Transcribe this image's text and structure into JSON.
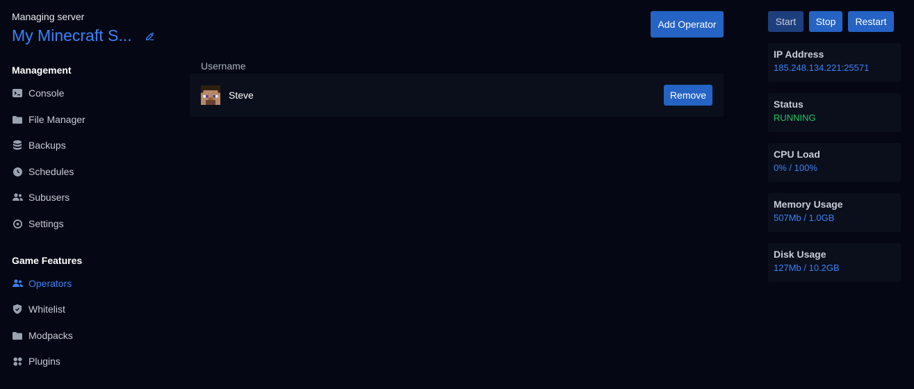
{
  "sidebar": {
    "managing_label": "Managing server",
    "server_name": "My Minecraft S...",
    "management_title": "Management",
    "management_items": [
      {
        "label": "Console",
        "icon": "terminal-icon"
      },
      {
        "label": "File Manager",
        "icon": "folder-icon"
      },
      {
        "label": "Backups",
        "icon": "database-icon"
      },
      {
        "label": "Schedules",
        "icon": "clock-icon"
      },
      {
        "label": "Subusers",
        "icon": "users-icon"
      },
      {
        "label": "Settings",
        "icon": "gear-icon"
      }
    ],
    "game_title": "Game Features",
    "game_items": [
      {
        "label": "Operators",
        "icon": "users-icon",
        "active": true
      },
      {
        "label": "Whitelist",
        "icon": "shield-icon"
      },
      {
        "label": "Modpacks",
        "icon": "folder-icon"
      },
      {
        "label": "Plugins",
        "icon": "puzzle-icon"
      }
    ]
  },
  "main": {
    "add_button": "Add Operator",
    "column_header": "Username",
    "operators": [
      {
        "name": "Steve",
        "remove_label": "Remove"
      }
    ]
  },
  "power": {
    "start": "Start",
    "stop": "Stop",
    "restart": "Restart"
  },
  "stats": [
    {
      "label": "IP Address",
      "value": "185.248.134.221:25571"
    },
    {
      "label": "Status",
      "value": "RUNNING"
    },
    {
      "label": "CPU Load",
      "value": "0% / 100%"
    },
    {
      "label": "Memory Usage",
      "value": "507Mb / 1.0GB"
    },
    {
      "label": "Disk Usage",
      "value": "127Mb / 10.2GB"
    }
  ],
  "colors": {
    "background": "#050814",
    "accent": "#3b82f6",
    "button": "#2563c4",
    "running": "#22c55e",
    "card": "#0b0f1c"
  }
}
